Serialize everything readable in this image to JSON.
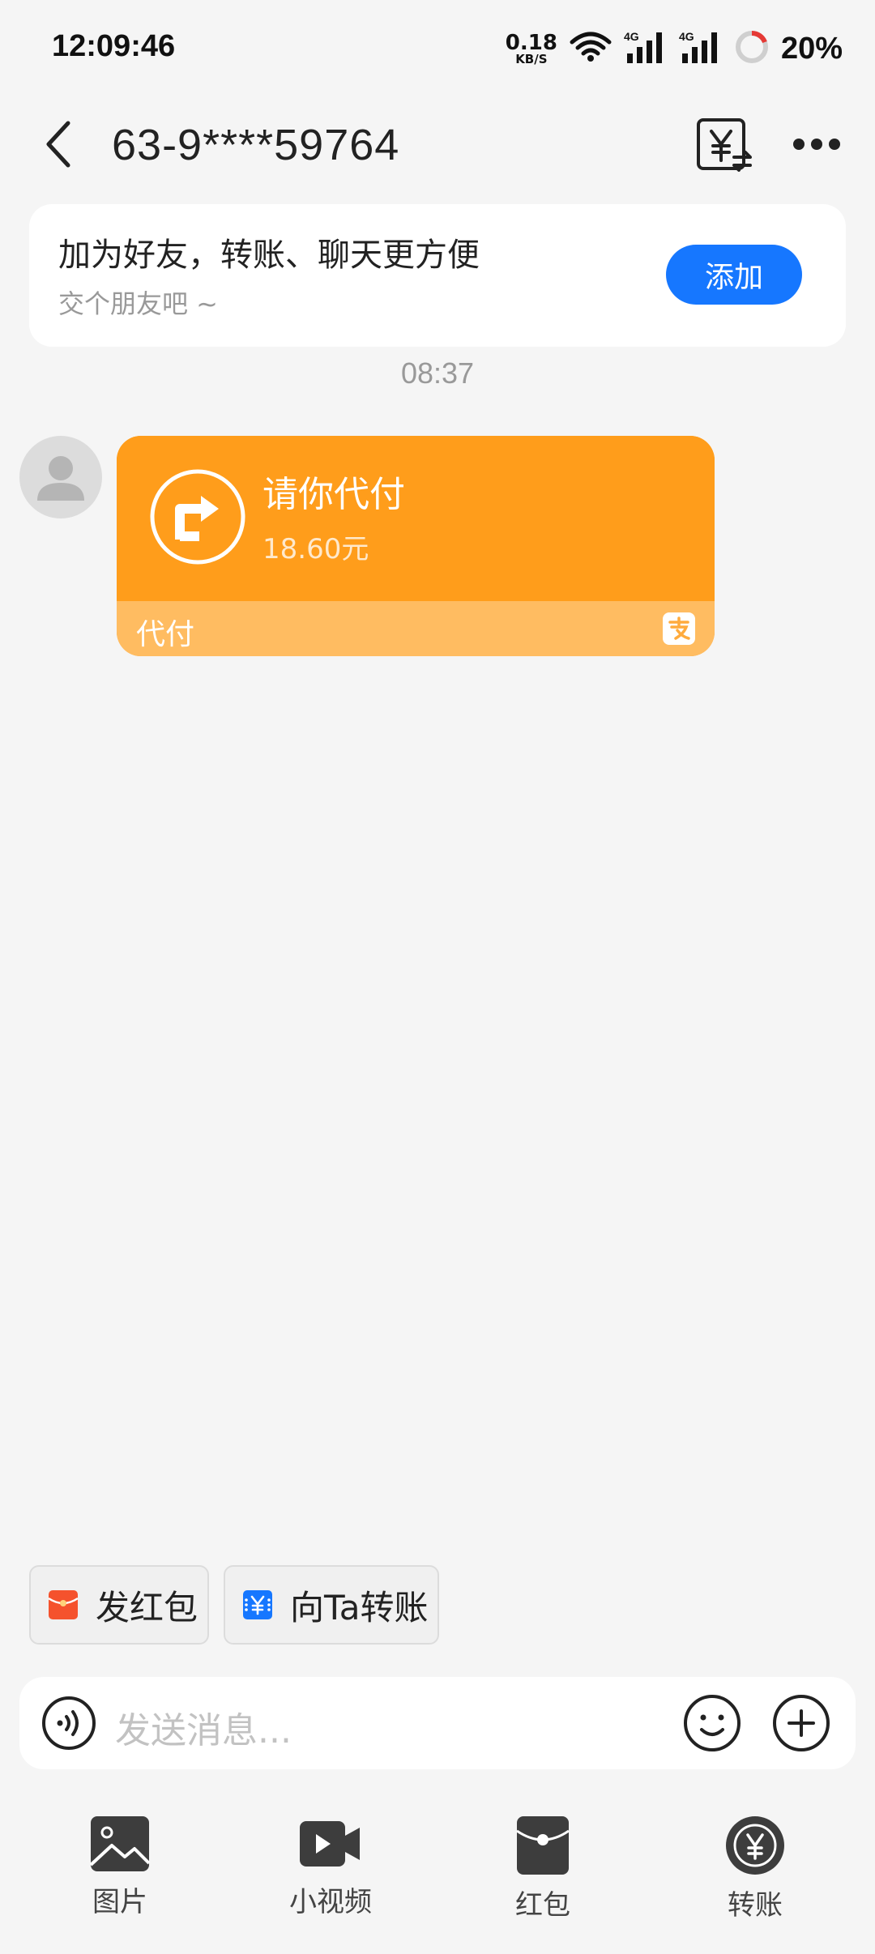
{
  "status_bar": {
    "time": "12:09:46",
    "net_speed_value": "0.18",
    "net_speed_unit": "KB/S",
    "battery": "20%",
    "icons": [
      "wifi-icon",
      "signal-4g-icon",
      "signal-4g-icon",
      "battery-icon"
    ]
  },
  "header": {
    "title": "63-9****59764",
    "back_icon": "chevron-left-icon",
    "convert_icon": "yuan-convert-icon",
    "more_icon": "more-dots-icon"
  },
  "friend_banner": {
    "title": "加为好友，转账、聊天更方便",
    "subtitle": "交个朋友吧 ~",
    "add_label": "添加"
  },
  "chat": {
    "time": "08:37",
    "messages": [
      {
        "type": "pay-request-card",
        "title": "请你代付",
        "amount": "18.60元",
        "footer_label": "代付",
        "color": "#ff9d1b"
      }
    ]
  },
  "quick_actions": [
    {
      "label": "发红包",
      "icon": "red-packet-icon",
      "color": "#f5522d"
    },
    {
      "label": "向Ta转账",
      "icon": "transfer-yuan-icon",
      "color": "#1677ff"
    }
  ],
  "input_bar": {
    "placeholder": "发送消息...",
    "voice_icon": "voice-icon",
    "emoji_icon": "emoji-icon",
    "plus_icon": "plus-icon"
  },
  "bottom_tools": [
    {
      "label": "图片",
      "icon": "image-icon"
    },
    {
      "label": "小视频",
      "icon": "video-icon"
    },
    {
      "label": "红包",
      "icon": "red-packet-icon"
    },
    {
      "label": "转账",
      "icon": "transfer-icon"
    }
  ],
  "colors": {
    "accent": "#1677ff",
    "card_orange": "#ff9d1b",
    "background": "#f5f5f5"
  }
}
